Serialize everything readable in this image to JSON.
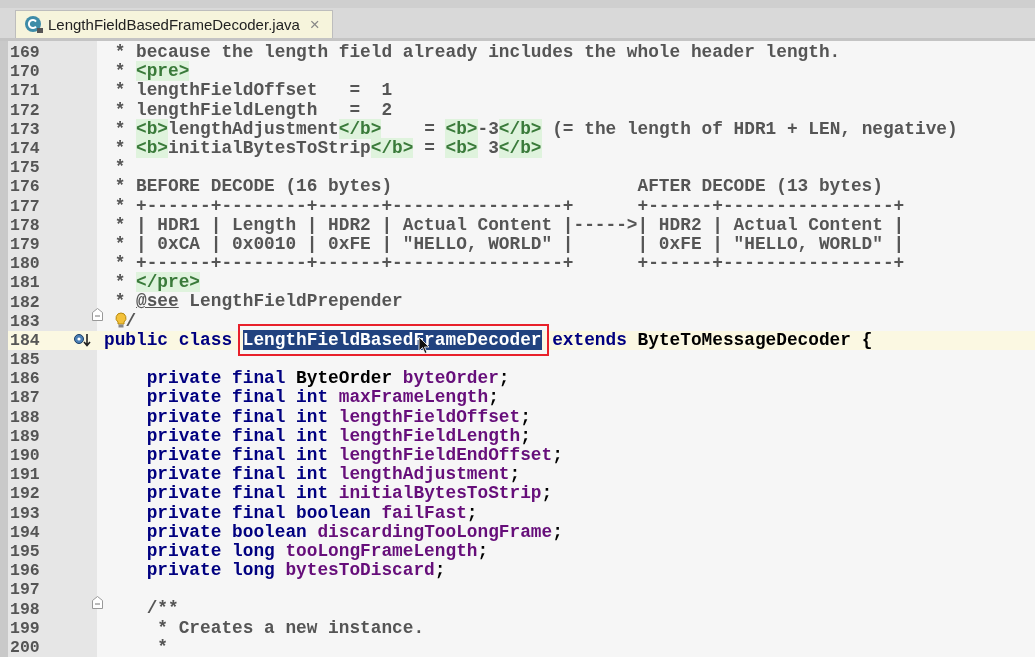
{
  "tab": {
    "title": "LengthFieldBasedFrameDecoder.java",
    "close": "×",
    "selected": true
  },
  "lines": [
    {
      "number": "169",
      "current": false,
      "fold_marker": false,
      "implemented": false,
      "tokens": [
        {
          "kind": "comment",
          "text": " * because the length field already includes the whole header length."
        }
      ]
    },
    {
      "number": "170",
      "current": false,
      "fold_marker": false,
      "implemented": false,
      "tokens": [
        {
          "kind": "comment",
          "text": " * "
        },
        {
          "kind": "tag",
          "text": "<pre>"
        }
      ]
    },
    {
      "number": "171",
      "current": false,
      "fold_marker": false,
      "implemented": false,
      "tokens": [
        {
          "kind": "comment",
          "text": " * lengthFieldOffset   =  1"
        }
      ]
    },
    {
      "number": "172",
      "current": false,
      "fold_marker": false,
      "implemented": false,
      "tokens": [
        {
          "kind": "comment",
          "text": " * lengthFieldLength   =  2"
        }
      ]
    },
    {
      "number": "173",
      "current": false,
      "fold_marker": false,
      "implemented": false,
      "tokens": [
        {
          "kind": "comment",
          "text": " * "
        },
        {
          "kind": "tag",
          "text": "<b>"
        },
        {
          "kind": "comment",
          "text": "lengthAdjustment"
        },
        {
          "kind": "tag",
          "text": "</b>"
        },
        {
          "kind": "comment",
          "text": "    = "
        },
        {
          "kind": "tag",
          "text": "<b>"
        },
        {
          "kind": "comment",
          "text": "-3"
        },
        {
          "kind": "tag",
          "text": "</b>"
        },
        {
          "kind": "comment",
          "text": " (= the length of HDR1 + LEN, negative)"
        }
      ]
    },
    {
      "number": "174",
      "current": false,
      "fold_marker": false,
      "implemented": false,
      "tokens": [
        {
          "kind": "comment",
          "text": " * "
        },
        {
          "kind": "tag",
          "text": "<b>"
        },
        {
          "kind": "comment",
          "text": "initialBytesToStrip"
        },
        {
          "kind": "tag",
          "text": "</b>"
        },
        {
          "kind": "comment",
          "text": " = "
        },
        {
          "kind": "tag",
          "text": "<b>"
        },
        {
          "kind": "comment",
          "text": " 3"
        },
        {
          "kind": "tag",
          "text": "</b>"
        }
      ]
    },
    {
      "number": "175",
      "current": false,
      "fold_marker": false,
      "implemented": false,
      "tokens": [
        {
          "kind": "comment",
          "text": " *"
        }
      ]
    },
    {
      "number": "176",
      "current": false,
      "fold_marker": false,
      "implemented": false,
      "tokens": [
        {
          "kind": "comment",
          "text": " * BEFORE DECODE (16 bytes)                       AFTER DECODE (13 bytes)"
        }
      ]
    },
    {
      "number": "177",
      "current": false,
      "fold_marker": false,
      "implemented": false,
      "tokens": [
        {
          "kind": "comment",
          "text": " * +------+--------+------+----------------+      +------+----------------+"
        }
      ]
    },
    {
      "number": "178",
      "current": false,
      "fold_marker": false,
      "implemented": false,
      "tokens": [
        {
          "kind": "comment",
          "text": " * | HDR1 | Length | HDR2 | Actual Content |----->| HDR2 | Actual Content |"
        }
      ]
    },
    {
      "number": "179",
      "current": false,
      "fold_marker": false,
      "implemented": false,
      "tokens": [
        {
          "kind": "comment",
          "text": " * | 0xCA | 0x0010 | 0xFE | \"HELLO, WORLD\" |      | 0xFE | \"HELLO, WORLD\" |"
        }
      ]
    },
    {
      "number": "180",
      "current": false,
      "fold_marker": false,
      "implemented": false,
      "tokens": [
        {
          "kind": "comment",
          "text": " * +------+--------+------+----------------+      +------+----------------+"
        }
      ]
    },
    {
      "number": "181",
      "current": false,
      "fold_marker": false,
      "implemented": false,
      "tokens": [
        {
          "kind": "comment",
          "text": " * "
        },
        {
          "kind": "tag",
          "text": "</pre>"
        }
      ]
    },
    {
      "number": "182",
      "current": false,
      "fold_marker": false,
      "implemented": false,
      "tokens": [
        {
          "kind": "comment",
          "text": " * "
        },
        {
          "kind": "doctag",
          "text": "@see"
        },
        {
          "kind": "comment",
          "text": " LengthFieldPrepender"
        }
      ]
    },
    {
      "number": "183",
      "current": false,
      "fold_marker": true,
      "implemented": false,
      "tokens": [
        {
          "kind": "bulb"
        },
        {
          "kind": "comment",
          "text": "/"
        }
      ]
    },
    {
      "number": "184",
      "current": true,
      "fold_marker": false,
      "implemented": true,
      "tokens": [
        {
          "kind": "keyword",
          "text": "public class "
        },
        {
          "kind": "selection",
          "text": "LengthFieldBasedFrameDecoder"
        },
        {
          "kind": "keyword",
          "text": " extends"
        },
        {
          "kind": "plain",
          "text": " ByteToMessageDecoder {"
        }
      ]
    },
    {
      "number": "185",
      "current": false,
      "fold_marker": false,
      "implemented": false
    },
    {
      "number": "186",
      "current": false,
      "fold_marker": false,
      "implemented": false,
      "tokens": [
        {
          "kind": "keyword",
          "text": "    private final"
        },
        {
          "kind": "plain",
          "text": " ByteOrder "
        },
        {
          "kind": "field",
          "text": "byteOrder"
        },
        {
          "kind": "plain",
          "text": ";"
        }
      ]
    },
    {
      "number": "187",
      "current": false,
      "fold_marker": false,
      "implemented": false,
      "tokens": [
        {
          "kind": "keyword",
          "text": "    private final int "
        },
        {
          "kind": "field",
          "text": "maxFrameLength"
        },
        {
          "kind": "plain",
          "text": ";"
        }
      ]
    },
    {
      "number": "188",
      "current": false,
      "fold_marker": false,
      "implemented": false,
      "tokens": [
        {
          "kind": "keyword",
          "text": "    private final int "
        },
        {
          "kind": "field",
          "text": "lengthFieldOffset"
        },
        {
          "kind": "plain",
          "text": ";"
        }
      ]
    },
    {
      "number": "189",
      "current": false,
      "fold_marker": false,
      "implemented": false,
      "tokens": [
        {
          "kind": "keyword",
          "text": "    private final int "
        },
        {
          "kind": "field",
          "text": "lengthFieldLength"
        },
        {
          "kind": "plain",
          "text": ";"
        }
      ]
    },
    {
      "number": "190",
      "current": false,
      "fold_marker": false,
      "implemented": false,
      "tokens": [
        {
          "kind": "keyword",
          "text": "    private final int "
        },
        {
          "kind": "field",
          "text": "lengthFieldEndOffset"
        },
        {
          "kind": "plain",
          "text": ";"
        }
      ]
    },
    {
      "number": "191",
      "current": false,
      "fold_marker": false,
      "implemented": false,
      "tokens": [
        {
          "kind": "keyword",
          "text": "    private final int "
        },
        {
          "kind": "field",
          "text": "lengthAdjustment"
        },
        {
          "kind": "plain",
          "text": ";"
        }
      ]
    },
    {
      "number": "192",
      "current": false,
      "fold_marker": false,
      "implemented": false,
      "tokens": [
        {
          "kind": "keyword",
          "text": "    private final int "
        },
        {
          "kind": "field",
          "text": "initialBytesToStrip"
        },
        {
          "kind": "plain",
          "text": ";"
        }
      ]
    },
    {
      "number": "193",
      "current": false,
      "fold_marker": false,
      "implemented": false,
      "tokens": [
        {
          "kind": "keyword",
          "text": "    private final boolean "
        },
        {
          "kind": "field",
          "text": "failFast"
        },
        {
          "kind": "plain",
          "text": ";"
        }
      ]
    },
    {
      "number": "194",
      "current": false,
      "fold_marker": false,
      "implemented": false,
      "tokens": [
        {
          "kind": "keyword",
          "text": "    private boolean "
        },
        {
          "kind": "field",
          "text": "discardingTooLongFrame"
        },
        {
          "kind": "plain",
          "text": ";"
        }
      ]
    },
    {
      "number": "195",
      "current": false,
      "fold_marker": false,
      "implemented": false,
      "tokens": [
        {
          "kind": "keyword",
          "text": "    private long "
        },
        {
          "kind": "field",
          "text": "tooLongFrameLength"
        },
        {
          "kind": "plain",
          "text": ";"
        }
      ]
    },
    {
      "number": "196",
      "current": false,
      "fold_marker": false,
      "implemented": false,
      "tokens": [
        {
          "kind": "keyword",
          "text": "    private long "
        },
        {
          "kind": "field",
          "text": "bytesToDiscard"
        },
        {
          "kind": "plain",
          "text": ";"
        }
      ]
    },
    {
      "number": "197",
      "current": false,
      "fold_marker": false,
      "implemented": false
    },
    {
      "number": "198",
      "current": false,
      "fold_marker": true,
      "implemented": false,
      "tokens": [
        {
          "kind": "comment",
          "text": "    /**"
        }
      ]
    },
    {
      "number": "199",
      "current": false,
      "fold_marker": false,
      "implemented": false,
      "tokens": [
        {
          "kind": "comment",
          "text": "     * Creates a new instance."
        }
      ]
    },
    {
      "number": "200",
      "current": false,
      "fold_marker": false,
      "implemented": false,
      "tokens": [
        {
          "kind": "comment",
          "text": "     *"
        }
      ]
    }
  ]
}
